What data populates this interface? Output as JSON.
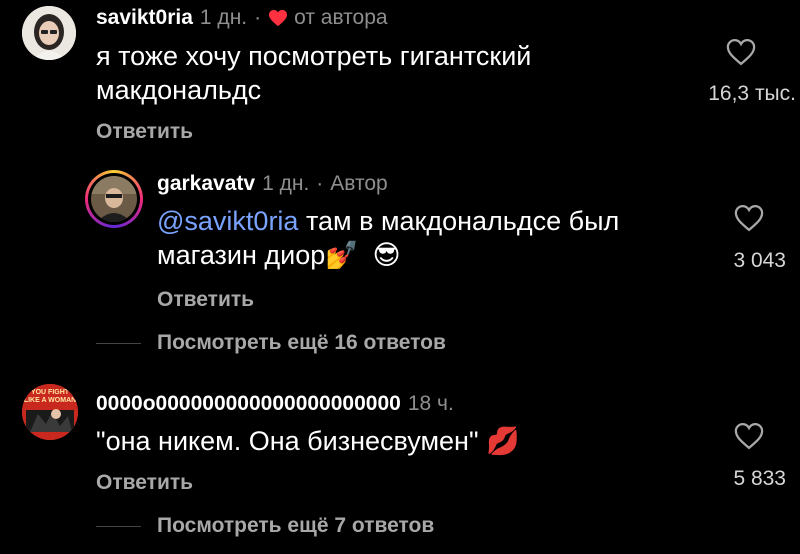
{
  "comments": [
    {
      "username": "savikt0ria",
      "time": "1 дн.",
      "separator": "·",
      "author_like_label": "от автора",
      "text_line1": "я тоже хочу посмотреть гигантский",
      "text_line2": "макдональдс",
      "likes": "16,3 тыс.",
      "reply_label": "Ответить",
      "replies": [
        {
          "username": "garkavatv",
          "time": "1 дн.",
          "separator": "·",
          "role": "Автор",
          "mention": "@savikt0ria",
          "text_line1_rest": " там в макдональдсе был",
          "text_line2": "магазин диор",
          "emoji1": "💅",
          "emoji2": "😎",
          "likes": "3 043",
          "reply_label": "Ответить"
        }
      ],
      "more_replies_label": "Посмотреть ещё 16 ответов"
    },
    {
      "username": "0000o000000000000000000000",
      "time": "18 ч.",
      "text": "\"она никем. Она бизнесвумен\"",
      "emoji": "💋",
      "likes": "5 833",
      "reply_label": "Ответить",
      "more_replies_label": "Посмотреть ещё 7 ответов",
      "avatar_text_line1": "YOU FIGHT",
      "avatar_text_line2": "LIKE A WOMAN"
    }
  ],
  "colors": {
    "background": "#000000",
    "text": "#ffffff",
    "meta": "#8e8e8e",
    "mention": "#7aa3ff",
    "heart_red": "#ff3040"
  },
  "icons": {
    "like": "heart-outline-icon",
    "author_like": "heart-filled-icon"
  }
}
